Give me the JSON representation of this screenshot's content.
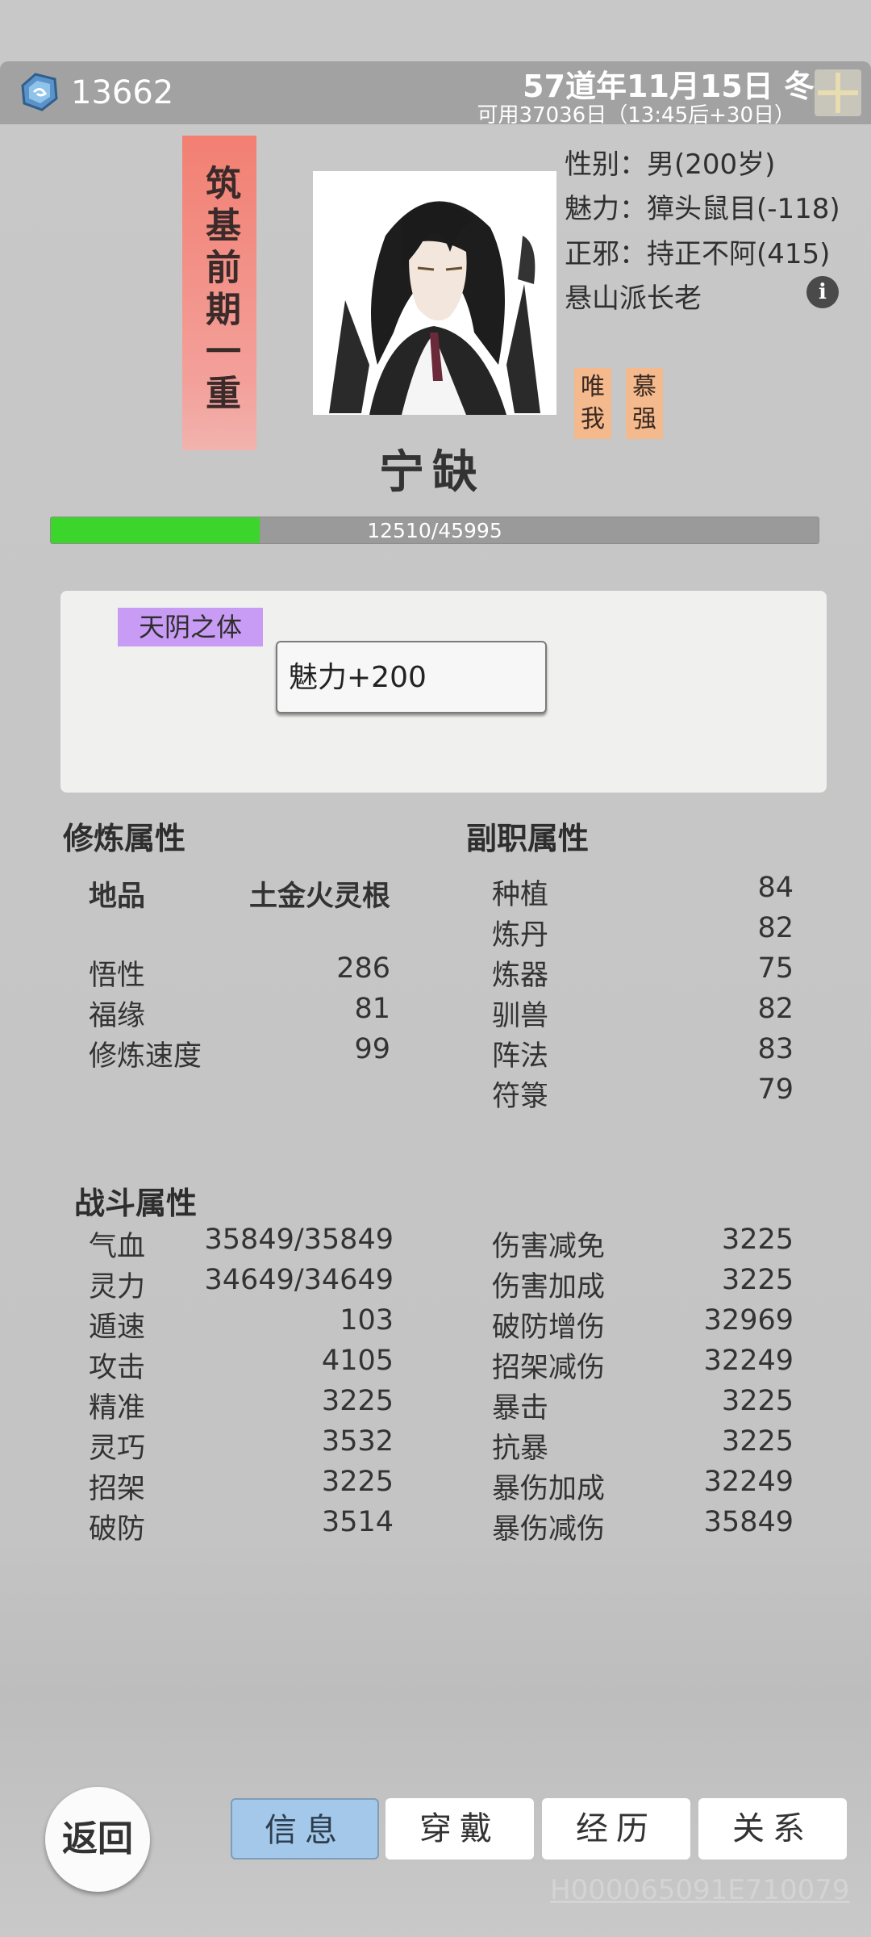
{
  "top_bar": {
    "currency_icon": "spirit-stone-icon",
    "currency": "13662",
    "date": "57道年11月15日 冬",
    "days_available": "可用37036日（13:45后+30日）",
    "add_icon": "plus-icon"
  },
  "character": {
    "realm": "筑基前期一重",
    "name": "宁缺",
    "gender": "性别：男(200岁)",
    "charm": "魅力：獐头鼠目(-118)",
    "alignment": "正邪：持正不阿(415)",
    "sect_role": "悬山派长老",
    "info_icon": "info-icon",
    "tags": [
      "唯我",
      "慕强"
    ]
  },
  "experience": {
    "current": 12510,
    "max": 45995,
    "text": "12510/45995",
    "fill_color": "#3bd52b"
  },
  "trait": {
    "name": "天阴之体",
    "tooltip": "魅力+200",
    "tag_color": "#c89bf4"
  },
  "cultivation": {
    "heading": "修炼属性",
    "grade": "地品",
    "root": "土金火灵根",
    "stats": [
      {
        "label": "悟性",
        "value": "286"
      },
      {
        "label": "福缘",
        "value": "81"
      },
      {
        "label": "修炼速度",
        "value": "99"
      }
    ]
  },
  "secondary": {
    "heading": "副职属性",
    "stats": [
      {
        "label": "种植",
        "value": "84"
      },
      {
        "label": "炼丹",
        "value": "82"
      },
      {
        "label": "炼器",
        "value": "75"
      },
      {
        "label": "驯兽",
        "value": "82"
      },
      {
        "label": "阵法",
        "value": "83"
      },
      {
        "label": "符箓",
        "value": "79"
      }
    ]
  },
  "combat": {
    "heading": "战斗属性",
    "left": [
      {
        "label": "气血",
        "value": "35849/35849"
      },
      {
        "label": "灵力",
        "value": "34649/34649"
      },
      {
        "label": "遁速",
        "value": "103"
      },
      {
        "label": "攻击",
        "value": "4105"
      },
      {
        "label": "精准",
        "value": "3225"
      },
      {
        "label": "灵巧",
        "value": "3532"
      },
      {
        "label": "招架",
        "value": "3225"
      },
      {
        "label": "破防",
        "value": "3514"
      }
    ],
    "right": [
      {
        "label": "伤害减免",
        "value": "3225"
      },
      {
        "label": "伤害加成",
        "value": "3225"
      },
      {
        "label": "破防增伤",
        "value": "32969"
      },
      {
        "label": "招架减伤",
        "value": "32249"
      },
      {
        "label": "暴击",
        "value": "3225"
      },
      {
        "label": "抗暴",
        "value": "3225"
      },
      {
        "label": "暴伤加成",
        "value": "32249"
      },
      {
        "label": "暴伤减伤",
        "value": "35849"
      }
    ]
  },
  "bottom": {
    "back": "返回",
    "tabs": [
      "信息",
      "穿戴",
      "经历",
      "关系"
    ],
    "active_tab": "信息",
    "build_id": "H000065091E710079"
  }
}
